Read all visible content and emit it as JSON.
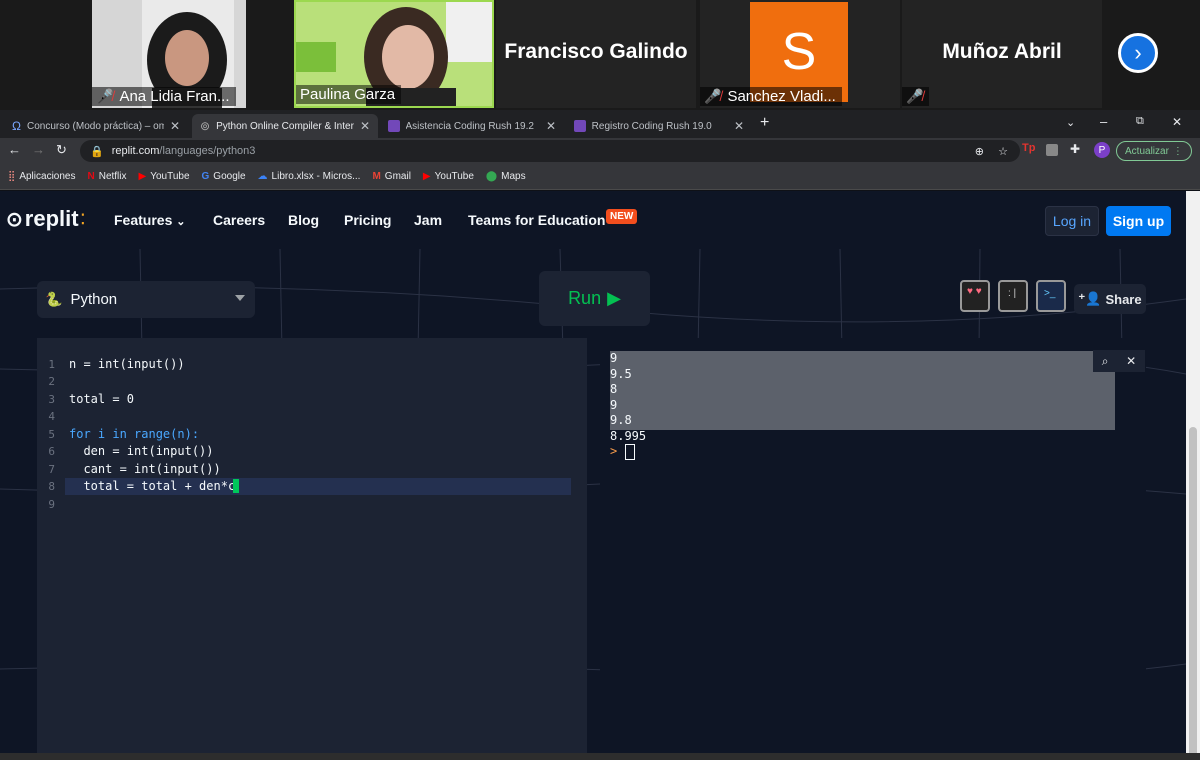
{
  "participants": [
    {
      "name": "Ana Lidia Fran...",
      "muted": true
    },
    {
      "name": "Paulina Garza",
      "muted": false
    },
    {
      "name": "Francisco Galindo"
    },
    {
      "name": "Sanchez Vladi...",
      "muted": true,
      "avatar_letter": "S"
    },
    {
      "name": "Muñoz Abril",
      "muted": true
    }
  ],
  "browser": {
    "tabs": [
      {
        "title": "Concurso (Modo práctica) – ome",
        "icon": "omega-icon"
      },
      {
        "title": "Python Online Compiler & Interp",
        "icon": "replit-icon",
        "active": true
      },
      {
        "title": "Asistencia Coding Rush 19.2",
        "icon": "forms-icon"
      },
      {
        "title": "Registro Coding Rush 19.0",
        "icon": "forms-icon"
      }
    ],
    "url_host": "replit.com",
    "url_path": "/languages/python3",
    "update_label": "Actualizar",
    "profile_letter": "P",
    "bookmarks": [
      "Aplicaciones",
      "Netflix",
      "YouTube",
      "Google",
      "Libro.xlsx - Micros...",
      "Gmail",
      "YouTube",
      "Maps"
    ]
  },
  "site": {
    "logo": "replit",
    "nav": [
      "Features",
      "Careers",
      "Blog",
      "Pricing",
      "Jam",
      "Teams for Education"
    ],
    "new_badge": "NEW",
    "login": "Log in",
    "signup": "Sign up",
    "language": "Python",
    "run": "Run",
    "share": "Share"
  },
  "editor": {
    "lines": [
      {
        "n": "1",
        "text": "n = int(input())"
      },
      {
        "n": "2",
        "text": ""
      },
      {
        "n": "3",
        "text": "total = 0"
      },
      {
        "n": "4",
        "text": ""
      },
      {
        "n": "5",
        "text": "for i in range(n):"
      },
      {
        "n": "6",
        "text": "  den = int(input())"
      },
      {
        "n": "7",
        "text": "  cant = int(input())"
      },
      {
        "n": "8",
        "text": "  total = total + den*c"
      },
      {
        "n": "9",
        "text": ""
      }
    ]
  },
  "output": {
    "lines": [
      "9",
      "9.5",
      "8",
      "9",
      "9.8",
      "8.995"
    ],
    "prompt": ">"
  },
  "colors": {
    "accent": "#0079f2",
    "run_green": "#04c052",
    "bg": "#0e1525",
    "panel": "#1c2333"
  }
}
